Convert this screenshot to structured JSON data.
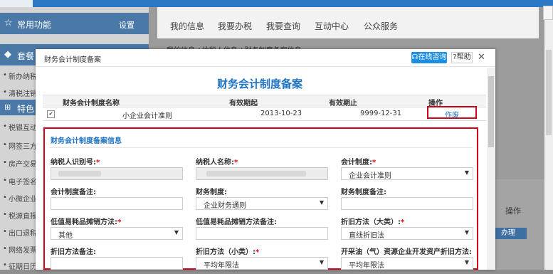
{
  "sidebar": {
    "common_title": "常用功能",
    "settings_label": "设置",
    "section2_title": "套餐",
    "special_title": "特色",
    "items": [
      "新办纳税",
      "清税注销",
      "税银互动",
      "网签三方",
      "房产交易",
      "电子签名",
      "小微企业",
      "税源直报",
      "出口退税",
      "网络发票",
      "征期日历"
    ]
  },
  "nav": {
    "tabs": [
      "我的信息",
      "我要办税",
      "我要查询",
      "互动中心",
      "公众服务"
    ],
    "breadcrumb": "› 我的信息 / 纳税人信息 / 财务制度备案信息"
  },
  "right_panel": {
    "header": "操作",
    "button": "办理"
  },
  "modal": {
    "header_title": "财务会计制度备案",
    "consult_label": "在线咨询",
    "help_label": "帮助",
    "close_label": "✕",
    "title": "财务会计制度备案",
    "table": {
      "headers": [
        "财务会计制度名称",
        "有效期起",
        "有效期止",
        "操作"
      ],
      "rows": [
        {
          "name": "小企业会计准则",
          "start": "2013-10-23",
          "end": "9999-12-31",
          "action": "作废"
        }
      ]
    },
    "info": {
      "title": "财务会计制度备案信息",
      "fields": {
        "taxpayer_id_label": "纳税人识别号:",
        "taxpayer_name_label": "纳税人名称:",
        "accounting_system_label": "会计制度:",
        "accounting_system_value": "企业会计准则",
        "accounting_note_label": "会计制度备注:",
        "finance_system_label": "财务制度:",
        "finance_system_value": "企业财务通则",
        "finance_note_label": "财务制度备注:",
        "low_value_method_label": "低值易耗品摊销方法:",
        "low_value_method_value": "其他",
        "low_value_note_label": "低值易耗品摊销方法备注:",
        "depr_major_label": "折旧方法（大类）:",
        "depr_major_value": "直线折旧法",
        "depr_note_label": "折旧方法备注:",
        "depr_minor_label": "折旧方法（小类）:",
        "depr_minor_value": "平均年限法",
        "mining_depr_label": "开采油（气）资源企业开发资产折旧方法:",
        "mining_depr_value": "平均年限法"
      }
    }
  },
  "colors": {
    "accent": "#1f74c4",
    "highlight": "#d0021b",
    "required": "#e00000"
  }
}
